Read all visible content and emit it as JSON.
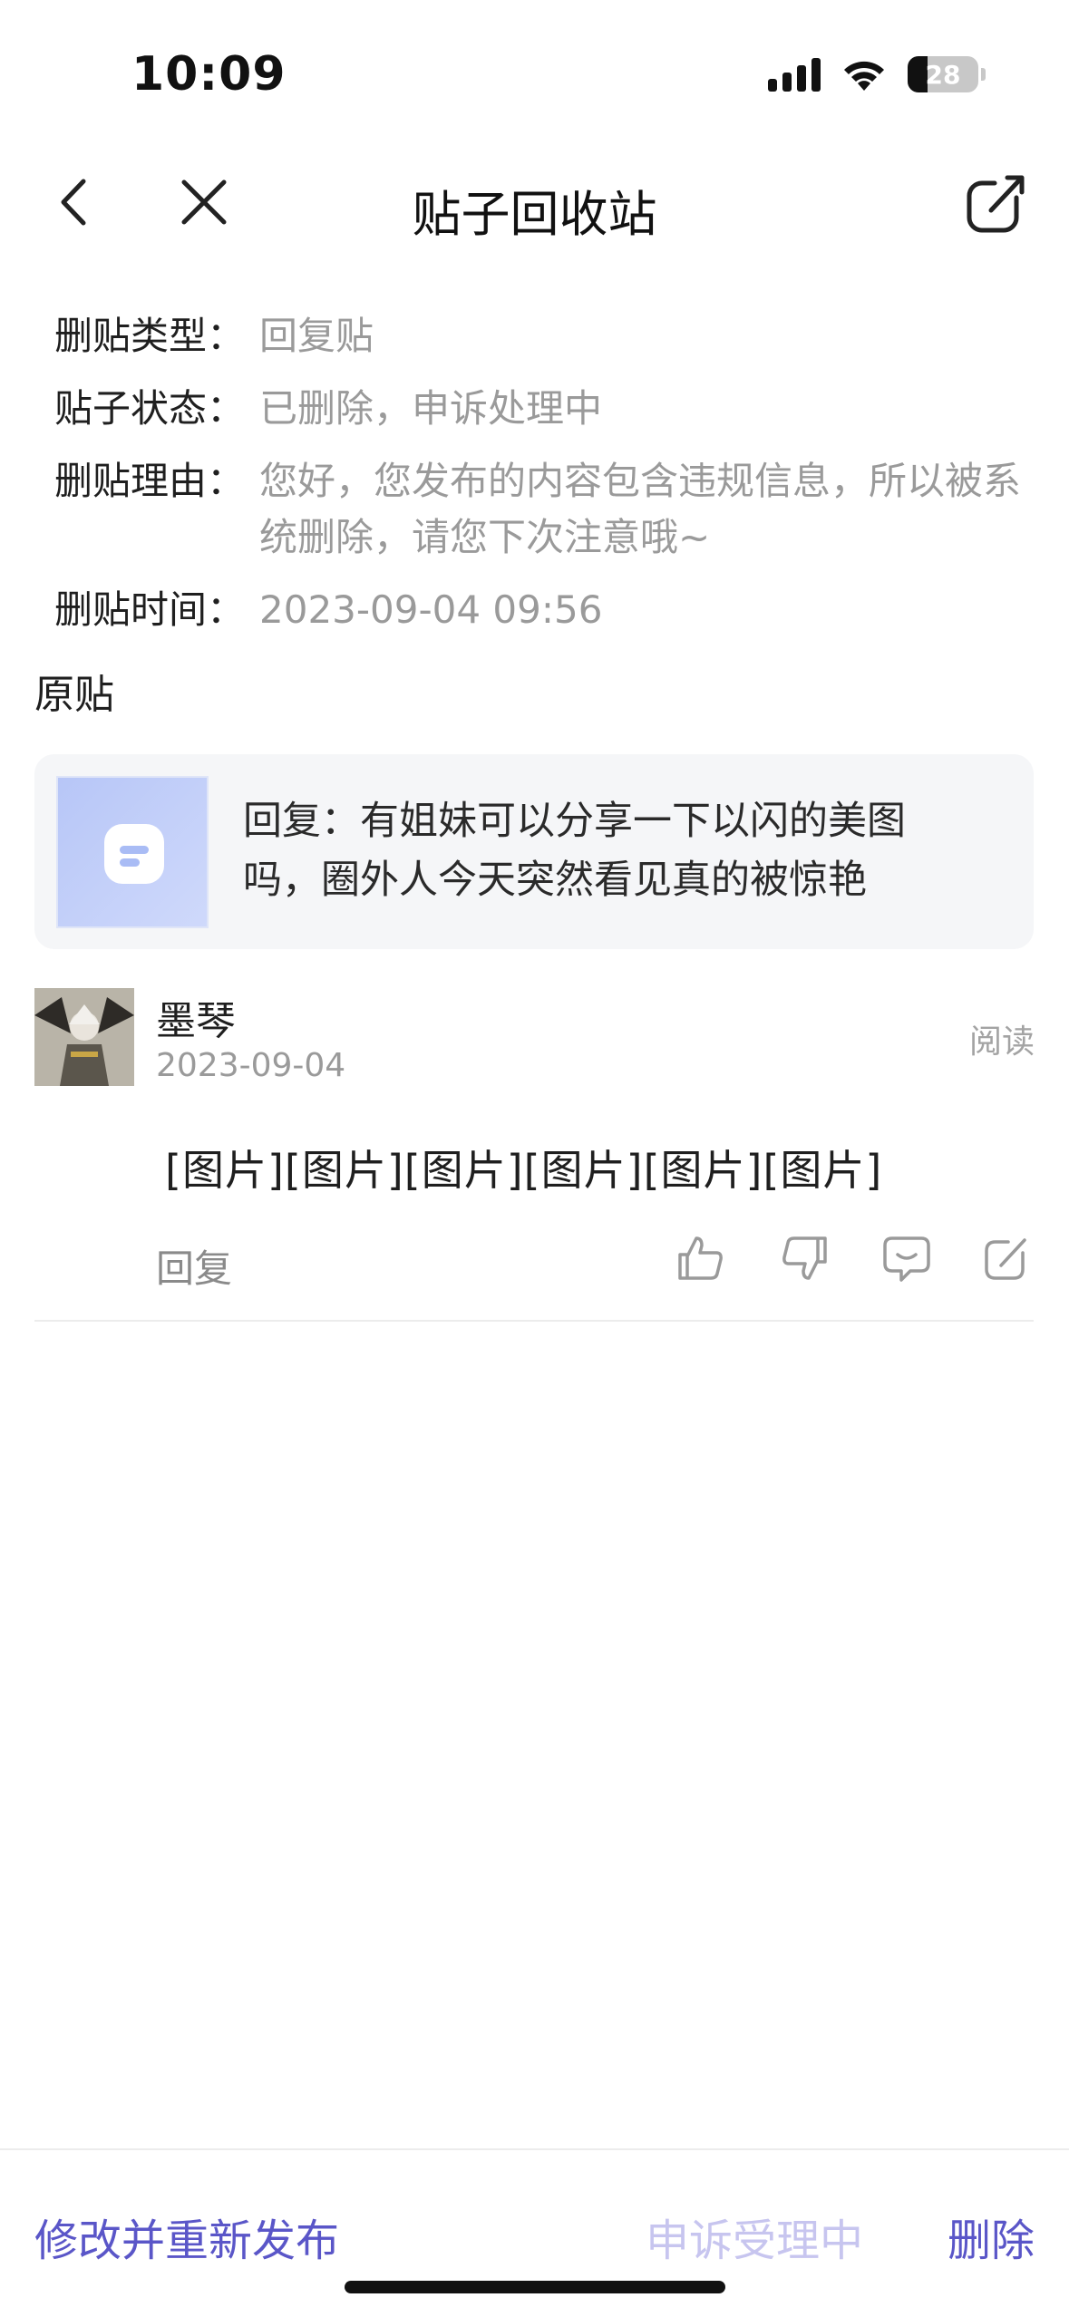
{
  "status_bar": {
    "time": "10:09",
    "battery": "28"
  },
  "nav": {
    "title": "贴子回收站"
  },
  "info": {
    "type_label": "删贴类型：",
    "type_value": "回复贴",
    "status_label": "贴子状态：",
    "status_value": "已删除，申诉处理中",
    "reason_label": "删贴理由：",
    "reason_value": "您好，您发布的内容包含违规信息，所以被系统删除，请您下次注意哦~",
    "time_label": "删贴时间：",
    "time_value": "2023-09-04 09:56"
  },
  "original": {
    "title": "原贴",
    "text": "回复：有姐妹可以分享一下以闪的美图吗，圈外人今天突然看见真的被惊艳"
  },
  "reply": {
    "username": "墨琴",
    "date": "2023-09-04",
    "read_label": "阅读",
    "content": "[图片][图片][图片][图片][图片][图片]",
    "reply_label": "回复"
  },
  "bottom": {
    "republish_label": "修改并重新发布",
    "appeal_label": "申诉受理中",
    "delete_label": "删除"
  },
  "colors": {
    "accent": "#5a56c8",
    "accent_disabled": "#c7c5ef",
    "muted_text": "#9a9a9a",
    "card_bg": "#f5f6f8"
  },
  "icons": [
    "back-icon",
    "close-icon",
    "share-icon",
    "like-icon",
    "dislike-icon",
    "comment-icon",
    "edit-icon"
  ]
}
